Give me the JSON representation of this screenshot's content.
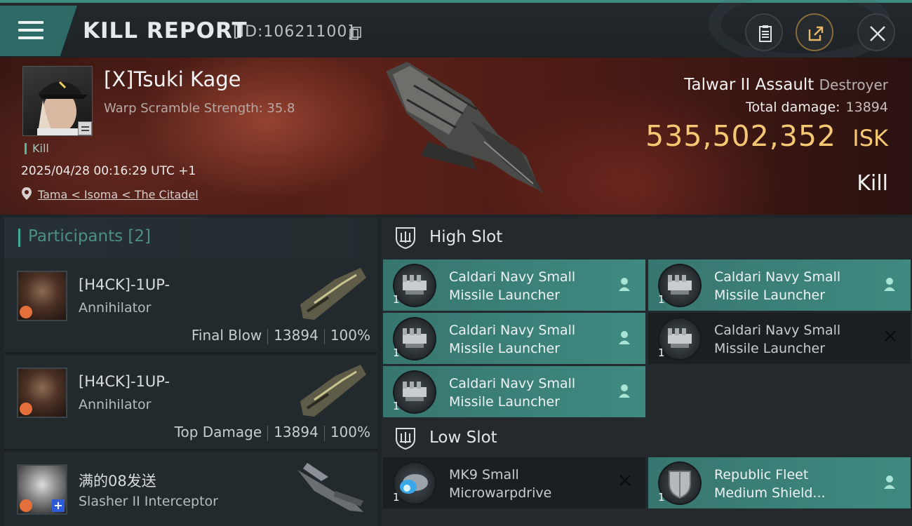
{
  "header": {
    "title": "KILL REPORT",
    "id_text": "[ID:10621100]"
  },
  "victim": {
    "name": "[X]Tsuki Kage",
    "warp_scramble": "Warp Scramble Strength: 35.8",
    "tag": "Kill",
    "datetime": "2025/04/28 00:16:29 UTC +1",
    "location": "Tama < Isoma < The Citadel",
    "ship_name": "Talwar II Assault",
    "ship_class": "Destroyer",
    "total_damage_label": "Total damage:",
    "total_damage": "13894",
    "isk_value": "535,502,352",
    "isk_unit": "ISK",
    "result": "Kill"
  },
  "participants": {
    "title": "Participants",
    "count": "[2]",
    "items": [
      {
        "name": "[H4CK]-1UP-",
        "ship": "Annihilator",
        "role": "Final Blow",
        "damage": "13894",
        "percent": "100%"
      },
      {
        "name": "[H4CK]-1UP-",
        "ship": "Annihilator",
        "role": "Top Damage",
        "damage": "13894",
        "percent": "100%"
      },
      {
        "name": "满的08发送",
        "ship": "Slasher II Interceptor"
      }
    ]
  },
  "high_slot": {
    "title": "High Slot",
    "modules": [
      {
        "line1": "Caldari Navy Small",
        "line2": "Missile Launcher",
        "qty": "1",
        "state": "on"
      },
      {
        "line1": "Caldari Navy Small",
        "line2": "Missile Launcher",
        "qty": "1",
        "state": "on"
      },
      {
        "line1": "Caldari Navy Small",
        "line2": "Missile Launcher",
        "qty": "1",
        "state": "on"
      },
      {
        "line1": "Caldari Navy Small",
        "line2": "Missile Launcher",
        "qty": "1",
        "state": "off"
      },
      {
        "line1": "Caldari Navy Small",
        "line2": "Missile Launcher",
        "qty": "1",
        "state": "on"
      }
    ]
  },
  "low_slot": {
    "title": "Low Slot",
    "modules": [
      {
        "line1": "MK9 Small",
        "line2": "Microwarpdrive",
        "qty": "1",
        "state": "off"
      },
      {
        "line1": "Republic Fleet",
        "line2": "Medium Shield...",
        "qty": "1",
        "state": "on"
      }
    ]
  },
  "colors": {
    "accent": "#3f8a80",
    "isk": "#f6c873",
    "banner": "#5b2118"
  },
  "icons": [
    "menu-icon",
    "copy-icon",
    "clipboard-icon",
    "share-icon",
    "close-icon",
    "pin-icon",
    "shield-icon",
    "pilot-icon",
    "destroyed-x-icon"
  ]
}
